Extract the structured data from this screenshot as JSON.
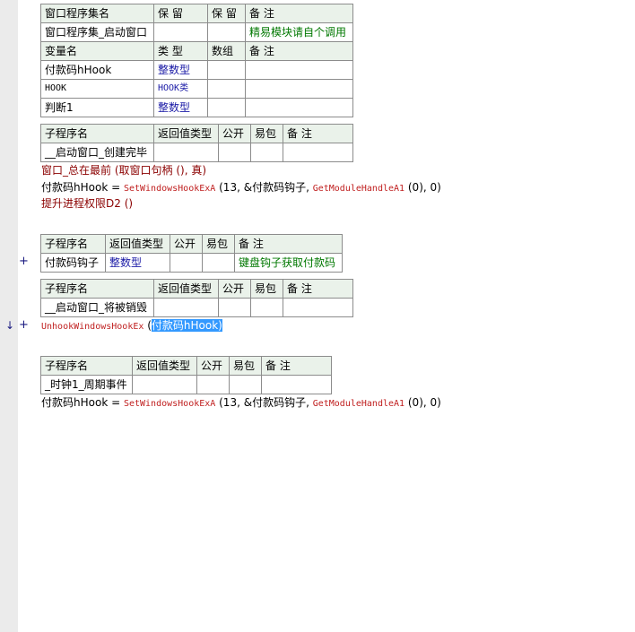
{
  "assembly": {
    "headers": [
      "窗口程序集名",
      "保 留",
      "保 留",
      "备 注"
    ],
    "row": [
      "窗口程序集_启动窗口",
      "",
      "",
      "精易模块请自个调用"
    ],
    "var_headers": [
      "变量名",
      "类 型",
      "数组",
      "备 注"
    ],
    "vars": [
      {
        "name": "付款码hHook",
        "type": "整数型"
      },
      {
        "name": "HOOK",
        "type": "HOOK类"
      },
      {
        "name": "判断1",
        "type": "整数型"
      }
    ]
  },
  "sub_headers": [
    "子程序名",
    "返回值类型",
    "公开",
    "易包",
    "备 注"
  ],
  "sub1": {
    "name": "__启动窗口_创建完毕",
    "lines": [
      {
        "a": "窗口_总在最前",
        "b": " (取窗口句柄 (), 真)"
      },
      {
        "a": "付款码hHook",
        "b": " = ",
        "c": "SetWindowsHookExA",
        "d": " (13, &付款码钩子, ",
        "e": "GetModuleHandleA1",
        "f": " (0), 0)"
      },
      {
        "a": "提升进程权限D2",
        "b": " ()"
      }
    ]
  },
  "sub2": {
    "name": "付款码钩子",
    "ret": "整数型",
    "note": "键盘钩子获取付款码"
  },
  "sub3": {
    "name": "__启动窗口_将被销毁",
    "line": {
      "fn": "UnhookWindowsHookEx",
      "open": " (",
      "arg": "付款码hHook",
      "close": ")"
    }
  },
  "sub4": {
    "name": "_时钟1_周期事件",
    "line": {
      "a": "付款码hHook",
      "b": " = ",
      "c": "SetWindowsHookExA",
      "d": " (13, &付款码钩子, ",
      "e": "GetModuleHandleA1",
      "f": " (0), 0)"
    }
  },
  "markers": {
    "plus": "+",
    "arrow": "↓"
  }
}
